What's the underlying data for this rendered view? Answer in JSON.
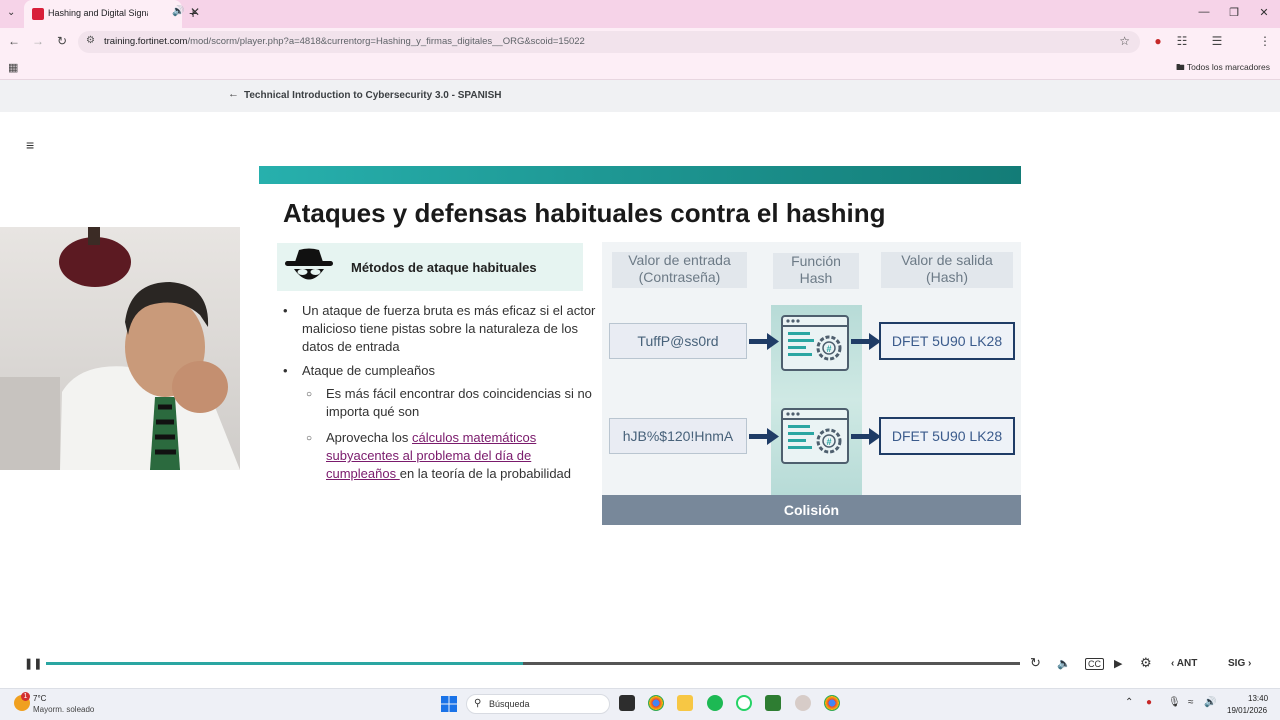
{
  "browser": {
    "tab_title": "Hashing and Digital Signatu",
    "url_host": "training.fortinet.com",
    "url_path": "/mod/scorm/player.php?a=4818&currentorg=Hashing_y_firmas_digitales__ORG&scoid=15022",
    "bookmarks_label": "Todos los marcadores"
  },
  "course": {
    "title": "Technical Introduction to Cybersecurity 3.0 - SPANISH"
  },
  "slide": {
    "title": "Ataques y defensas habituales contra el hashing",
    "methods_label": "Métodos de ataque habituales",
    "bullet1": "Un ataque de fuerza bruta es más eficaz si el actor malicioso tiene pistas sobre la naturaleza de los datos de entrada",
    "bullet2": "Ataque de cumpleaños",
    "sub1": "Es más fácil encontrar dos coincidencias si no importa qué son",
    "sub2_pre": "Aprovecha los ",
    "sub2_link": "cálculos matemáticos subyacentes al problema del día de cumpleaños ",
    "sub2_post": "en la teoría de la probabilidad",
    "diagram": {
      "col_input": "Valor de entrada (Contraseña)",
      "col_func": "Función Hash",
      "col_output": "Valor de salida (Hash)",
      "input1": "TuffP@ss0rd",
      "input2": "hJB%$120!HnmA",
      "output1": "DFET 5U90 LK28",
      "output2": "DFET 5U90 LK28",
      "collision": "Colisión"
    }
  },
  "player": {
    "progress": 0.49,
    "prev_label": "ANT",
    "next_label": "SIG"
  },
  "taskbar": {
    "weather_temp": "7°C",
    "weather_desc": "Mayorm. soleado",
    "weather_badge": "1",
    "search_label": "Búsqueda",
    "time": "13:40",
    "date": "19/01/2026"
  },
  "colors": {
    "accent_teal": "#1e9894",
    "link": "#7a1a6c",
    "outbox_border": "#1f3c66",
    "collision_bar": "#78889a"
  }
}
